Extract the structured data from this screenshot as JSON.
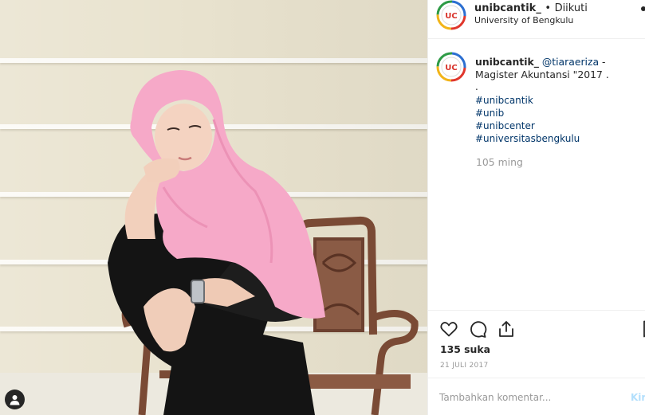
{
  "header": {
    "username": "unibcantik_",
    "separator": "•",
    "follow_status": "Diikuti",
    "location": "University of Bengkulu",
    "avatar_text": "UC"
  },
  "caption": {
    "username": "unibcantik_",
    "mention": "@tiaraeriza",
    "text": " - Magister Akuntansi \"2017 .",
    "dot": ".",
    "hashtags": [
      "#unibcantik",
      "#unib",
      "#unibcenter",
      "#universitasbengkulu"
    ],
    "time_ago": "105 ming"
  },
  "actions": {
    "icons": [
      "heart-icon",
      "comment-icon",
      "share-icon",
      "bookmark-icon"
    ],
    "likes": "135 suka",
    "date": "21 JULI 2017"
  },
  "comment": {
    "placeholder": "Tambahkan komentar...",
    "post_label": "Kirim"
  },
  "colors": {
    "hashtag": "#003569",
    "muted": "#999999",
    "post_button": "#b2dffc",
    "avatar_ring": [
      "#e0362c",
      "#f2b418",
      "#2e9b46",
      "#2c6fd1"
    ]
  }
}
